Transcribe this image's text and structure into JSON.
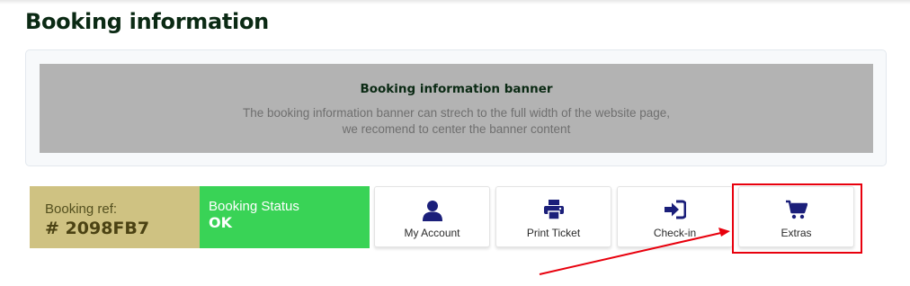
{
  "page": {
    "title": "Booking information"
  },
  "banner": {
    "title": "Booking information banner",
    "line1": "The booking information banner can strech to the full width of the website page,",
    "line2": "we recomend to center the banner content"
  },
  "booking": {
    "ref_label": "Booking ref:",
    "ref_value": "# 2098FB7",
    "status_label": "Booking Status",
    "status_value": "OK"
  },
  "actions": [
    {
      "label": "My Account",
      "icon": "user-icon"
    },
    {
      "label": "Print Ticket",
      "icon": "printer-icon"
    },
    {
      "label": "Check-in",
      "icon": "sign-in-icon"
    },
    {
      "label": "Extras",
      "icon": "cart-icon"
    }
  ],
  "colors": {
    "title": "#0b2a14",
    "ref_bg": "#cfc282",
    "status_bg": "#39d356",
    "icon": "#1b1f7a",
    "highlight": "#e8000d"
  }
}
